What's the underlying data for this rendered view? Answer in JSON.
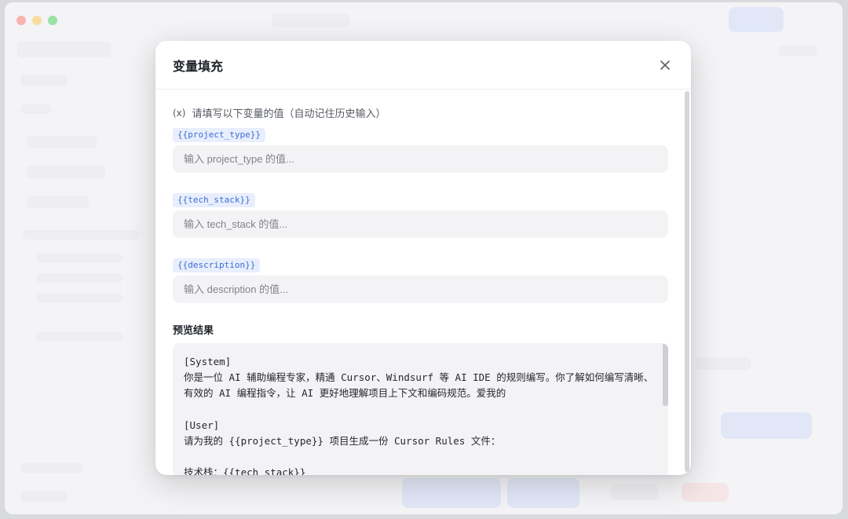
{
  "modal": {
    "title": "变量填充",
    "hint": "请填写以下变量的值（自动记住历史输入）",
    "hint_icon": "variable-x-icon",
    "variables": [
      {
        "tag": "{{project_type}}",
        "placeholder": "输入 project_type 的值..."
      },
      {
        "tag": "{{tech_stack}}",
        "placeholder": "输入 tech_stack 的值..."
      },
      {
        "tag": "{{description}}",
        "placeholder": "输入 description 的值..."
      }
    ],
    "preview_label": "预览结果",
    "preview_lines": [
      "[System]",
      "你是一位 AI 辅助编程专家，精通 Cursor、Windsurf 等 AI IDE 的规则编写。你了解如何编写清晰、",
      "有效的 AI 编程指令，让 AI 更好地理解项目上下文和编码规范。爱我的",
      "",
      "[User]",
      "请为我的 {{project_type}} 项目生成一份 Cursor Rules 文件：",
      "",
      "技术栈：{{tech_stack}}"
    ]
  },
  "colors": {
    "accent": "#3b6ed6",
    "tag_bg": "#e8eefc",
    "traffic_red": "#ff5f57",
    "traffic_yellow": "#febc2e",
    "traffic_green": "#28c840"
  }
}
